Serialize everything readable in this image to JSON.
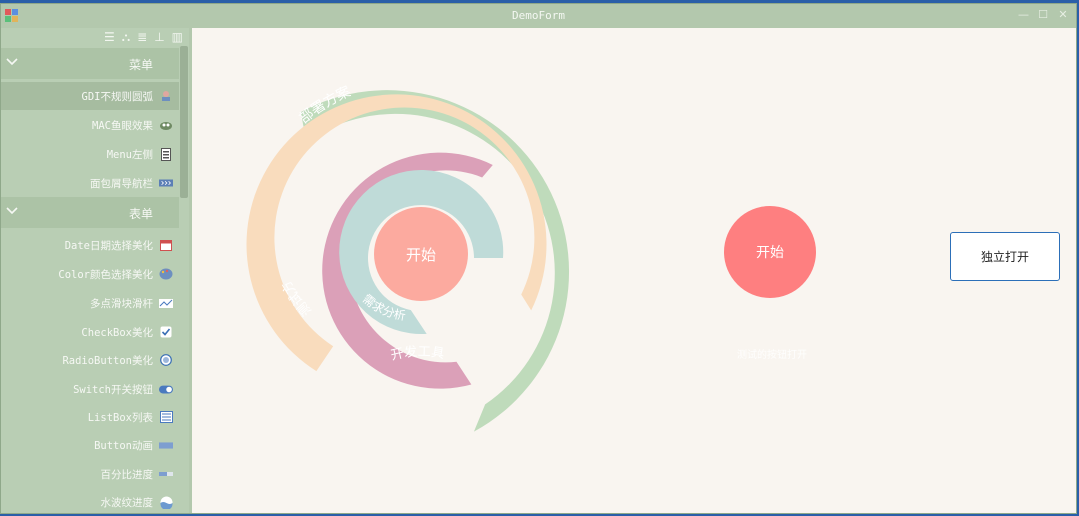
{
  "window": {
    "title": "DemoForm",
    "controls": [
      "—",
      "☐",
      "✕"
    ]
  },
  "sidebar": {
    "toolbar_icons": [
      "list-icon",
      "tree-icon",
      "hierarchy-icon",
      "pin-icon",
      "columns-icon"
    ],
    "groups": [
      {
        "label": "菜单",
        "items": [
          {
            "label": "GDI不规则圆弧",
            "icon": "arc-icon",
            "selected": true
          },
          {
            "label": "MAC鱼眼效果",
            "icon": "fisheye-icon",
            "selected": false
          },
          {
            "label": "Menu左侧",
            "icon": "menu-left-icon",
            "selected": false
          },
          {
            "label": "面包屑导航栏",
            "icon": "breadcrumb-icon",
            "selected": false
          }
        ]
      },
      {
        "label": "表单",
        "items": [
          {
            "label": "Date日期选择美化",
            "icon": "calendar-icon"
          },
          {
            "label": "Color颜色选择美化",
            "icon": "palette-icon"
          },
          {
            "label": "多点滑块滑杆",
            "icon": "slider-icon"
          },
          {
            "label": "CheckBox美化",
            "icon": "checkbox-icon"
          },
          {
            "label": "RadioButton美化",
            "icon": "radio-icon"
          },
          {
            "label": "Switch开关按钮",
            "icon": "toggle-icon"
          },
          {
            "label": "ListBox列表",
            "icon": "listbox-icon"
          },
          {
            "label": "Button动画",
            "icon": "button-icon"
          },
          {
            "label": "百分比进度",
            "icon": "percent-progress-icon"
          },
          {
            "label": "水波纹进度",
            "icon": "wave-progress-icon"
          }
        ]
      }
    ]
  },
  "main": {
    "ring_menu": {
      "center_label": "开始",
      "arcs": [
        {
          "label": "部署方案",
          "color": "#bfdbbb"
        },
        {
          "label": "测试方案",
          "color": "#f9dcbd"
        },
        {
          "label": "开发工具",
          "color": "#dba0b8"
        },
        {
          "label": "需求分析",
          "color": "#bfdbd8"
        }
      ],
      "center_color": "#fcaa9f"
    },
    "second_button": {
      "label": "开始",
      "color": "#fe7f80"
    },
    "faint_label": "测试的按钮打开",
    "open_button": {
      "label": "独立打开"
    }
  }
}
